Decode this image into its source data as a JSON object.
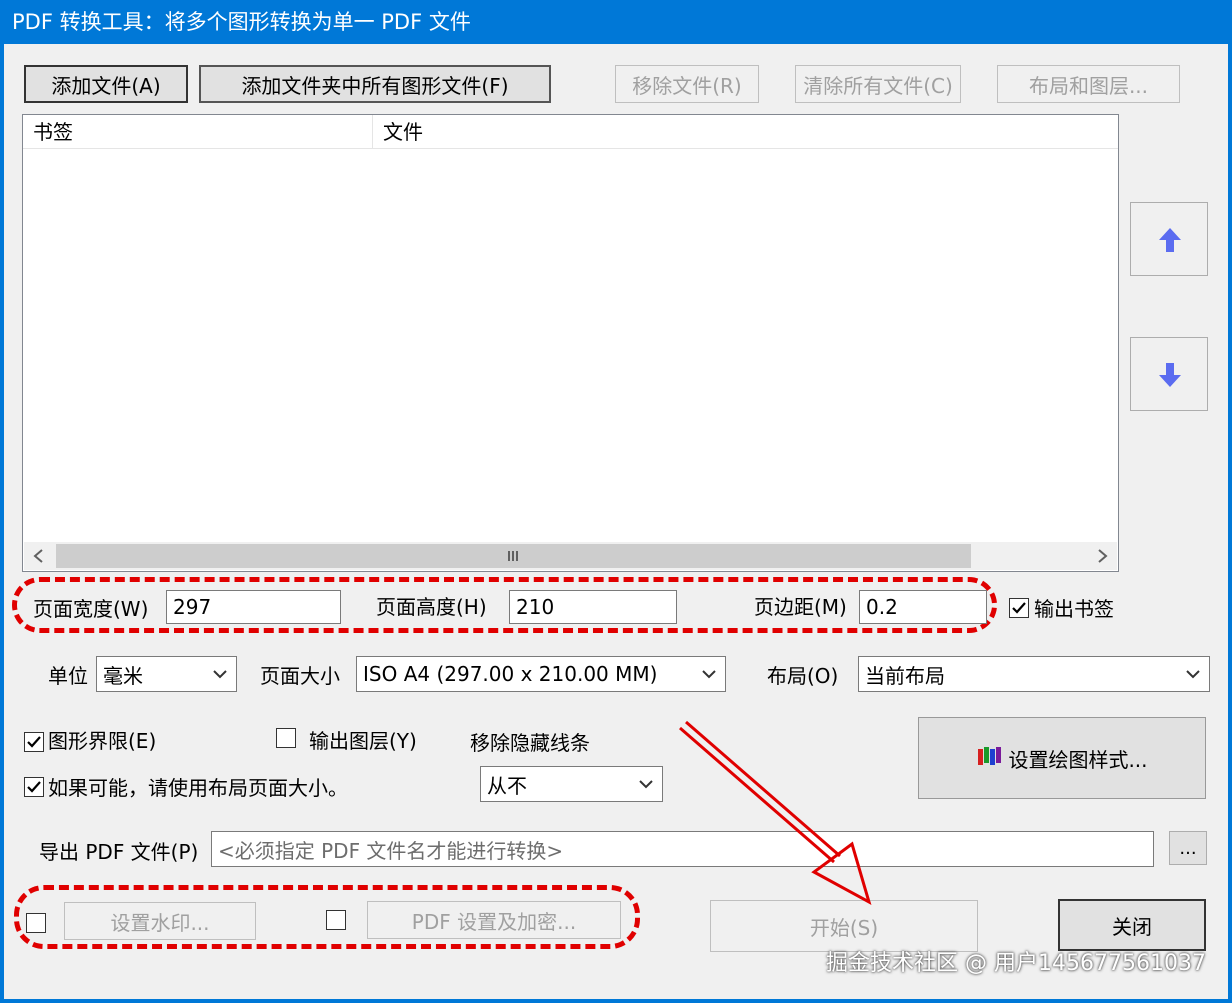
{
  "window": {
    "title": "PDF 转换工具：将多个图形转换为单一 PDF 文件"
  },
  "toolbar": {
    "add_files": "添加文件(A)",
    "add_folder": "添加文件夹中所有图形文件(F)",
    "remove": "移除文件(R)",
    "clear": "清除所有文件(C)",
    "layouts": "布局和图层..."
  },
  "list": {
    "columns": [
      "书签",
      "文件"
    ],
    "rows": []
  },
  "page": {
    "width_label": "页面宽度(W)",
    "width_value": "297",
    "height_label": "页面高度(H)",
    "height_value": "210",
    "margin_label": "页边距(M)",
    "margin_value": "0.2",
    "output_bookmarks": "输出书签",
    "output_bookmarks_checked": true
  },
  "units": {
    "label": "单位",
    "value": "毫米"
  },
  "page_size": {
    "label": "页面大小",
    "value": "ISO A4 (297.00 x 210.00 MM)"
  },
  "layout": {
    "label": "布局(O)",
    "value": "当前布局"
  },
  "options": {
    "extents": "图形界限(E)",
    "extents_checked": true,
    "output_layers": "输出图层(Y)",
    "output_layers_checked": false,
    "use_layout_size": "如果可能，请使用布局页面大小。",
    "use_layout_size_checked": true,
    "hidden_lines_label": "移除隐藏线条",
    "hidden_lines_value": "从不"
  },
  "plot_style_button": "设置绘图样式...",
  "export": {
    "label": "导出 PDF 文件(P)",
    "placeholder": "<必须指定 PDF 文件名才能进行转换>",
    "browse": "..."
  },
  "watermark": {
    "label": "设置水印...",
    "checked": false
  },
  "security": {
    "label": "PDF 设置及加密...",
    "checked": false
  },
  "actions": {
    "start": "开始(S)",
    "close": "关闭"
  },
  "overlay": {
    "credit": "掘金技术社区 @ 用户1456775610​37"
  },
  "colors": {
    "titlebar": "#0078d7",
    "annotation": "#e00000",
    "arrow_blue": "#5b6cf0"
  }
}
